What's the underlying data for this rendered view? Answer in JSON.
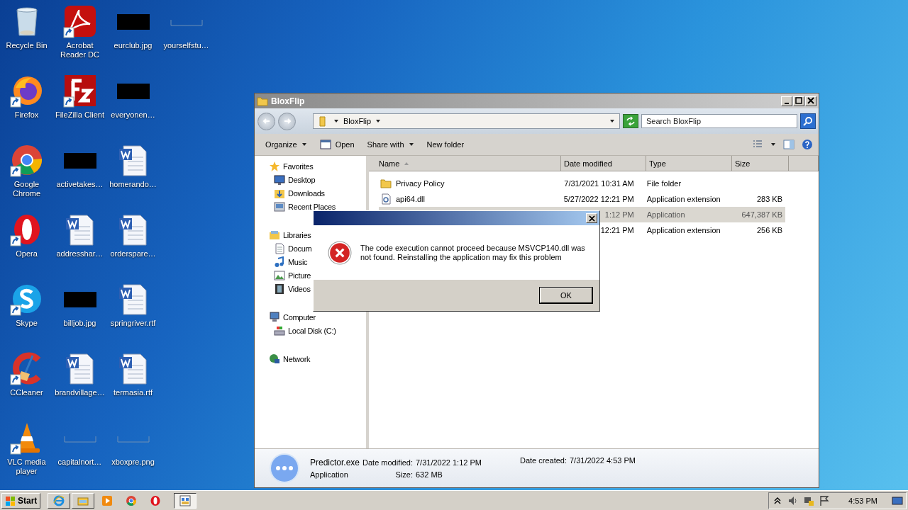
{
  "desktop_icons": [
    {
      "label": "Recycle Bin",
      "kind": "recycle",
      "shortcut": false
    },
    {
      "label": "Firefox",
      "kind": "firefox",
      "shortcut": true
    },
    {
      "label": "Google Chrome",
      "kind": "chrome",
      "shortcut": true
    },
    {
      "label": "Opera",
      "kind": "opera",
      "shortcut": true
    },
    {
      "label": "Skype",
      "kind": "skype",
      "shortcut": true
    },
    {
      "label": "CCleaner",
      "kind": "ccleaner",
      "shortcut": true
    },
    {
      "label": "VLC media player",
      "kind": "vlc",
      "shortcut": true
    },
    {
      "label": "Acrobat Reader DC",
      "kind": "acrobat",
      "shortcut": true
    },
    {
      "label": "FileZilla Client",
      "kind": "filezilla",
      "shortcut": true
    },
    {
      "label": "activetakes…",
      "kind": "dark-image",
      "shortcut": false
    },
    {
      "label": "addresshar…",
      "kind": "word",
      "shortcut": false
    },
    {
      "label": "billjob.jpg",
      "kind": "dark-image",
      "shortcut": false
    },
    {
      "label": "brandvillage…",
      "kind": "word",
      "shortcut": false
    },
    {
      "label": "capitalnort…",
      "kind": "blank-image",
      "shortcut": false
    },
    {
      "label": "eurclub.jpg",
      "kind": "dark-image",
      "shortcut": false
    },
    {
      "label": "everyonen…",
      "kind": "dark-image",
      "shortcut": false
    },
    {
      "label": "homerando…",
      "kind": "word",
      "shortcut": false
    },
    {
      "label": "orderspare…",
      "kind": "word",
      "shortcut": false
    },
    {
      "label": "springriver.rtf",
      "kind": "word",
      "shortcut": false
    },
    {
      "label": "termasia.rtf",
      "kind": "word",
      "shortcut": false
    },
    {
      "label": "xboxpre.png",
      "kind": "blank-image",
      "shortcut": false
    },
    {
      "label": "yourselfstu…",
      "kind": "blank-image",
      "shortcut": false
    }
  ],
  "explorer": {
    "title": "BloxFlip",
    "breadcrumb": "BloxFlip",
    "search": {
      "placeholder": "Search BloxFlip"
    },
    "toolbar": [
      {
        "label": "Organize",
        "kind": "menu"
      },
      {
        "label": "Open",
        "kind": "open"
      },
      {
        "label": "Share with",
        "kind": "menu"
      },
      {
        "label": "New folder",
        "kind": "plain"
      }
    ],
    "navigation_pane": [
      {
        "label": "Favorites",
        "kind": "star",
        "children": [
          {
            "label": "Desktop",
            "kind": "desktop"
          },
          {
            "label": "Downloads",
            "kind": "downloads"
          },
          {
            "label": "Recent Places",
            "kind": "recent"
          }
        ]
      },
      {
        "label": "Libraries",
        "kind": "libraries",
        "children": [
          {
            "label": "Docum",
            "kind": "documents"
          },
          {
            "label": "Music",
            "kind": "music"
          },
          {
            "label": "Picture",
            "kind": "pictures"
          },
          {
            "label": "Videos",
            "kind": "videos"
          }
        ]
      },
      {
        "label": "Computer",
        "kind": "computer",
        "children": [
          {
            "label": "Local Disk (C:)",
            "kind": "disk"
          }
        ]
      },
      {
        "label": "Network",
        "kind": "network"
      }
    ],
    "columns": [
      {
        "label": "Name",
        "sorted": true
      },
      {
        "label": "Date modified",
        "sorted": false
      },
      {
        "label": "Type",
        "sorted": false
      },
      {
        "label": "Size",
        "sorted": false
      }
    ],
    "files": [
      {
        "name": "Privacy Policy",
        "kind": "folder",
        "date_modified": "7/31/2021 10:31 AM",
        "type": "File folder",
        "selected": false
      },
      {
        "name": "api64.dll",
        "kind": "dll",
        "date_modified": "5/27/2022 12:21 PM",
        "type": "Application extension",
        "size": "283 KB",
        "selected": false
      },
      {
        "date_modified": "1:12 PM",
        "type": "Application",
        "size": "647,387 KB",
        "selected": true
      },
      {
        "date_modified": "12:21 PM",
        "type": "Application extension",
        "size": "256 KB",
        "selected": false
      }
    ],
    "details": {
      "name": "Predictor.exe",
      "type": "Application",
      "date_modified_label": "Date modified:",
      "date_modified": "7/31/2022 1:12 PM",
      "size_label": "Size:",
      "size": "632 MB",
      "date_created_label": "Date created:",
      "date_created": "7/31/2022 4:53 PM"
    }
  },
  "dialog": {
    "message": "The code execution cannot proceed because MSVCP140.dll was not found. Reinstalling the application may fix this problem",
    "button": "OK"
  },
  "taskbar": {
    "start": "Start",
    "quick_launch": [
      {
        "kind": "ie"
      },
      {
        "kind": "folder"
      },
      {
        "kind": "media"
      },
      {
        "kind": "chrome"
      },
      {
        "kind": "opera"
      }
    ],
    "tasks": [
      {
        "kind": "window",
        "selected": true
      }
    ],
    "time": "4:53 PM"
  }
}
